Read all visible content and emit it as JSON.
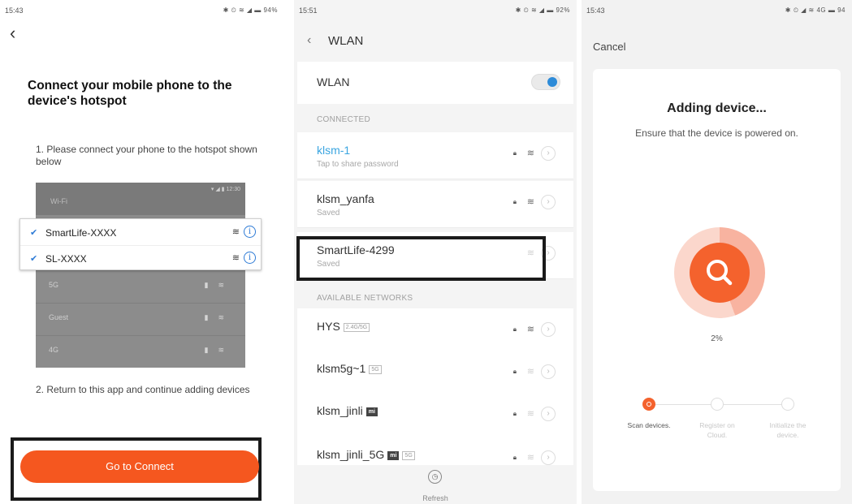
{
  "screen1": {
    "status_time": "15:43",
    "status_icons": "✱ ⏲ ≋ ◢ ▬ 94%",
    "back_icon": "chevron-left-icon",
    "title": "Connect your mobile phone to the device's hotspot",
    "step1": "1. Please connect your phone to the hotspot shown below",
    "wifi_image": {
      "header_label": "Wi-Fi",
      "header_status": "▾ ◢ ▮ 12:30",
      "dim_rows": [
        "5G",
        "Guest",
        "4G"
      ],
      "popup_networks": [
        "SmartLife-XXXX",
        "SL-XXXX"
      ]
    },
    "step2": "2. Return to this app and continue adding devices",
    "connect_button": "Go to Connect",
    "accent_color": "#f5571f"
  },
  "screen2": {
    "status_time": "15:51",
    "status_icons": "✱ ⏲ ≋ ◢ ▬ 92%",
    "header_title": "WLAN",
    "wlan_label": "WLAN",
    "wlan_enabled": true,
    "section_connected": "CONNECTED",
    "connected": [
      {
        "name": "klsm-1",
        "sub": "Tap to share password",
        "active": true
      },
      {
        "name": "klsm_yanfa",
        "sub": "Saved"
      },
      {
        "name": "SmartLife-4299",
        "sub": "Saved",
        "highlighted": true
      }
    ],
    "section_available": "AVAILABLE NETWORKS",
    "available": [
      {
        "name": "HYS",
        "tag": "2.4G/5G"
      },
      {
        "name": "klsm5g~1",
        "tag": "5G"
      },
      {
        "name": "klsm_jinli",
        "tag": "mi"
      },
      {
        "name": "klsm_jinli_5G",
        "tag": "mi",
        "tag2": "5G"
      }
    ],
    "refresh_label": "Refresh"
  },
  "screen3": {
    "status_time": "15:43",
    "status_icons": "✱ ⏲ ◢ ≋ 4G ▬ 94",
    "cancel_label": "Cancel",
    "title": "Adding device...",
    "subtitle": "Ensure that the device is powered on.",
    "progress_percent": "2%",
    "progress_value": 2,
    "steps": [
      {
        "label": "Scan devices.",
        "active": true
      },
      {
        "label": "Register on Cloud.",
        "active": false
      },
      {
        "label": "Initialize the device.",
        "active": false
      }
    ]
  }
}
